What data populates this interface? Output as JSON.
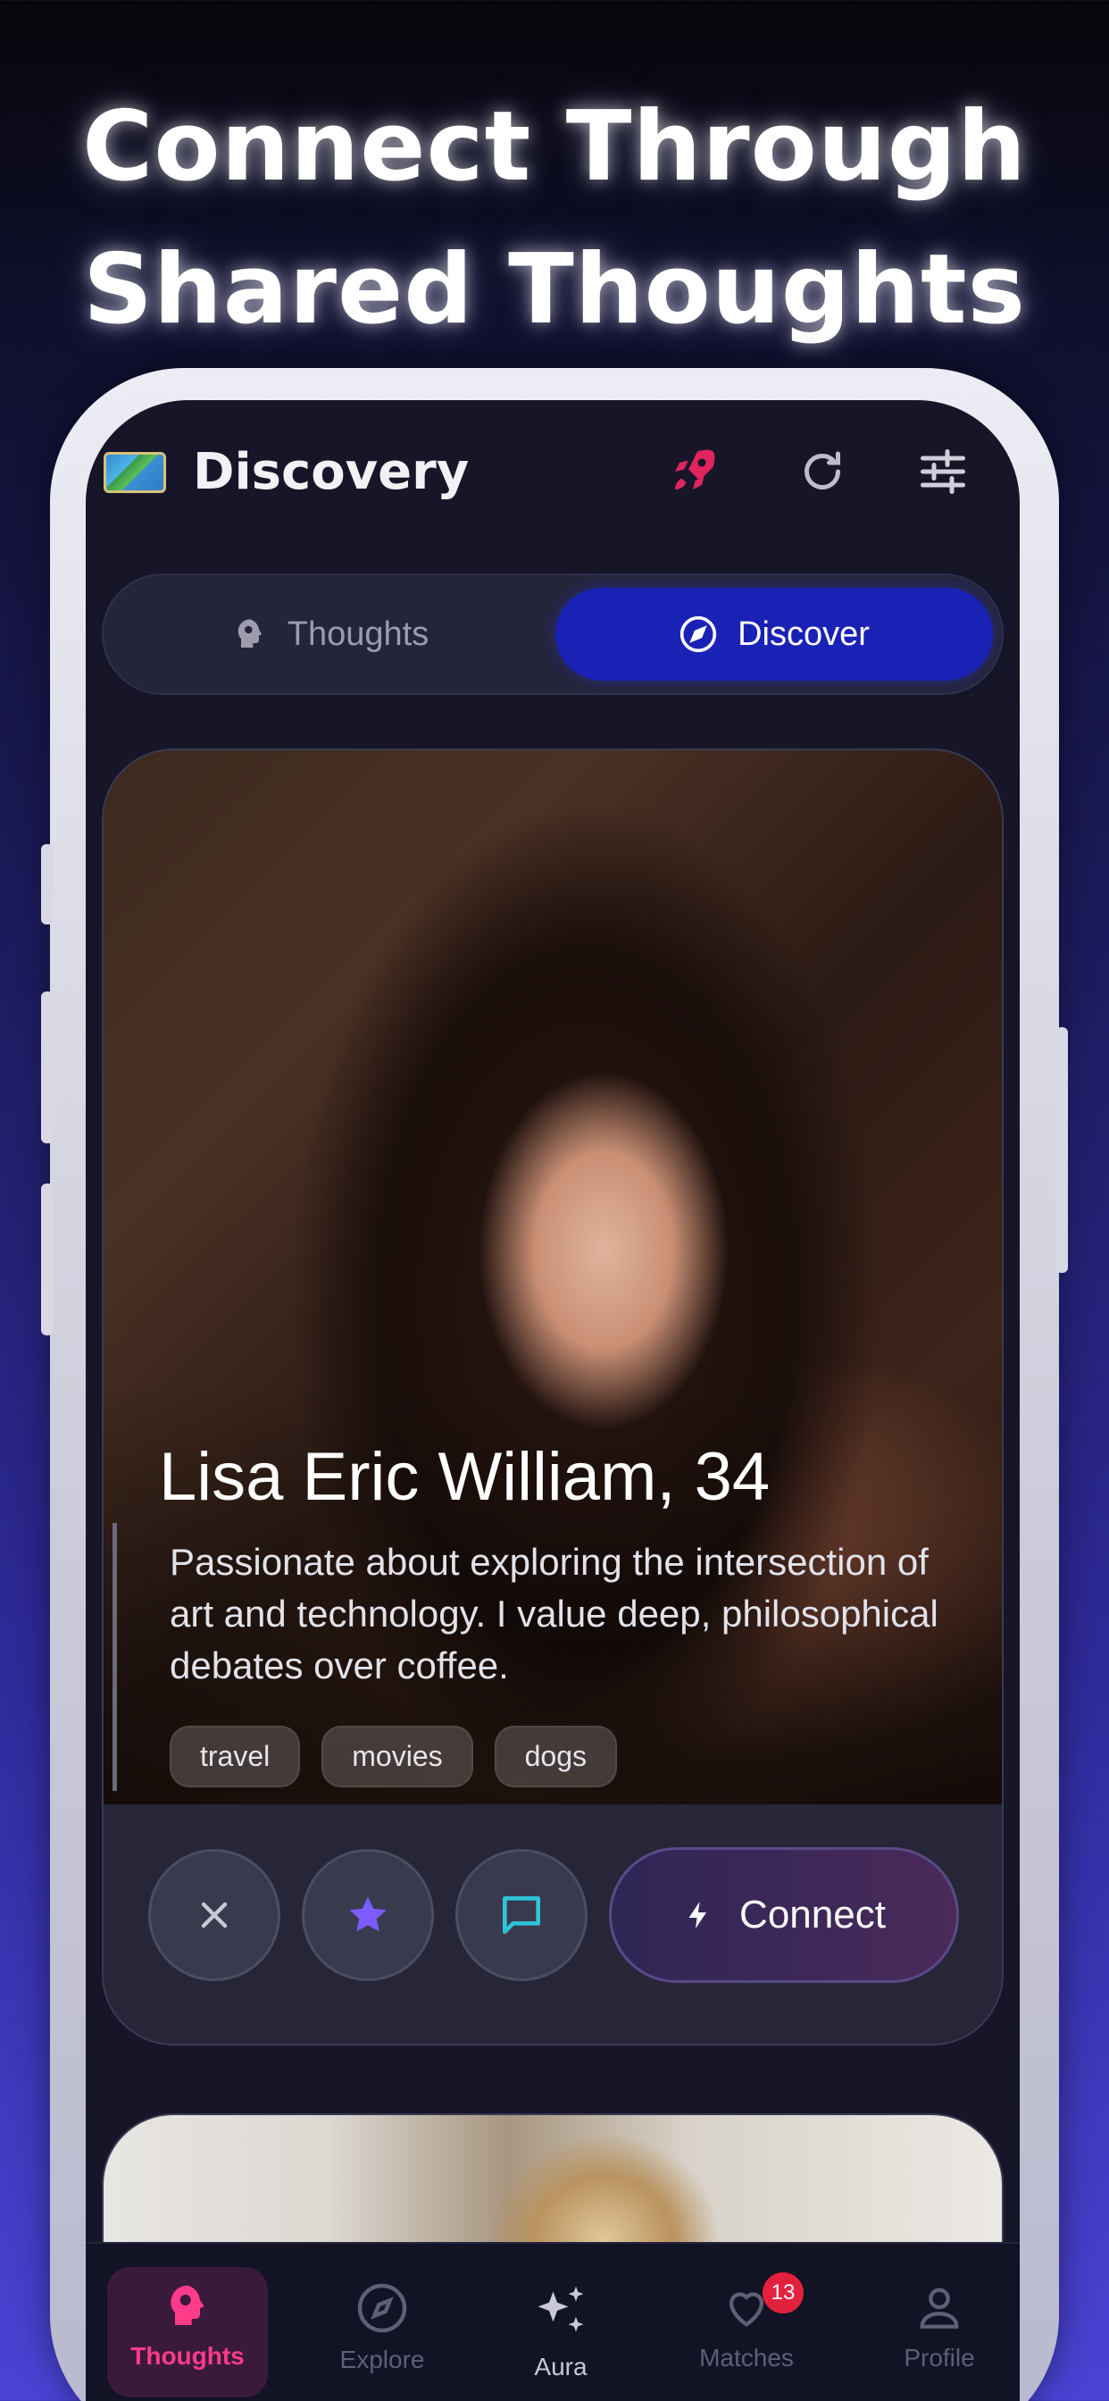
{
  "headline": {
    "line1": "Connect Through",
    "line2": "Shared Thoughts"
  },
  "app": {
    "title": "Discovery",
    "icons": [
      "map-icon",
      "rocket-icon",
      "refresh-icon",
      "filters-icon"
    ]
  },
  "segment": {
    "thoughts_label": "Thoughts",
    "discover_label": "Discover",
    "selected": "Discover"
  },
  "profile": {
    "name_age": "Lisa Eric William, 34",
    "bio": "Passionate about exploring the intersection of art and technology. I value deep, philosophical debates over coffee.",
    "tags": [
      "travel",
      "movies",
      "dogs"
    ],
    "connect_label": "Connect"
  },
  "nav": {
    "items": [
      {
        "label": "Thoughts",
        "icon": "brain-icon",
        "active": true
      },
      {
        "label": "Explore",
        "icon": "compass-icon"
      },
      {
        "label": "Aura",
        "icon": "sparkles-icon"
      },
      {
        "label": "Matches",
        "icon": "heart-icon",
        "badge": "13"
      },
      {
        "label": "Profile",
        "icon": "person-icon"
      }
    ]
  },
  "colors": {
    "accent_blue": "#1a22b6",
    "accent_pink": "#ff3b8a",
    "rocket_red": "#e0245e",
    "chat_cyan": "#2ec4d8",
    "star_purple": "#7c5cff",
    "badge_red": "#e3213f"
  }
}
